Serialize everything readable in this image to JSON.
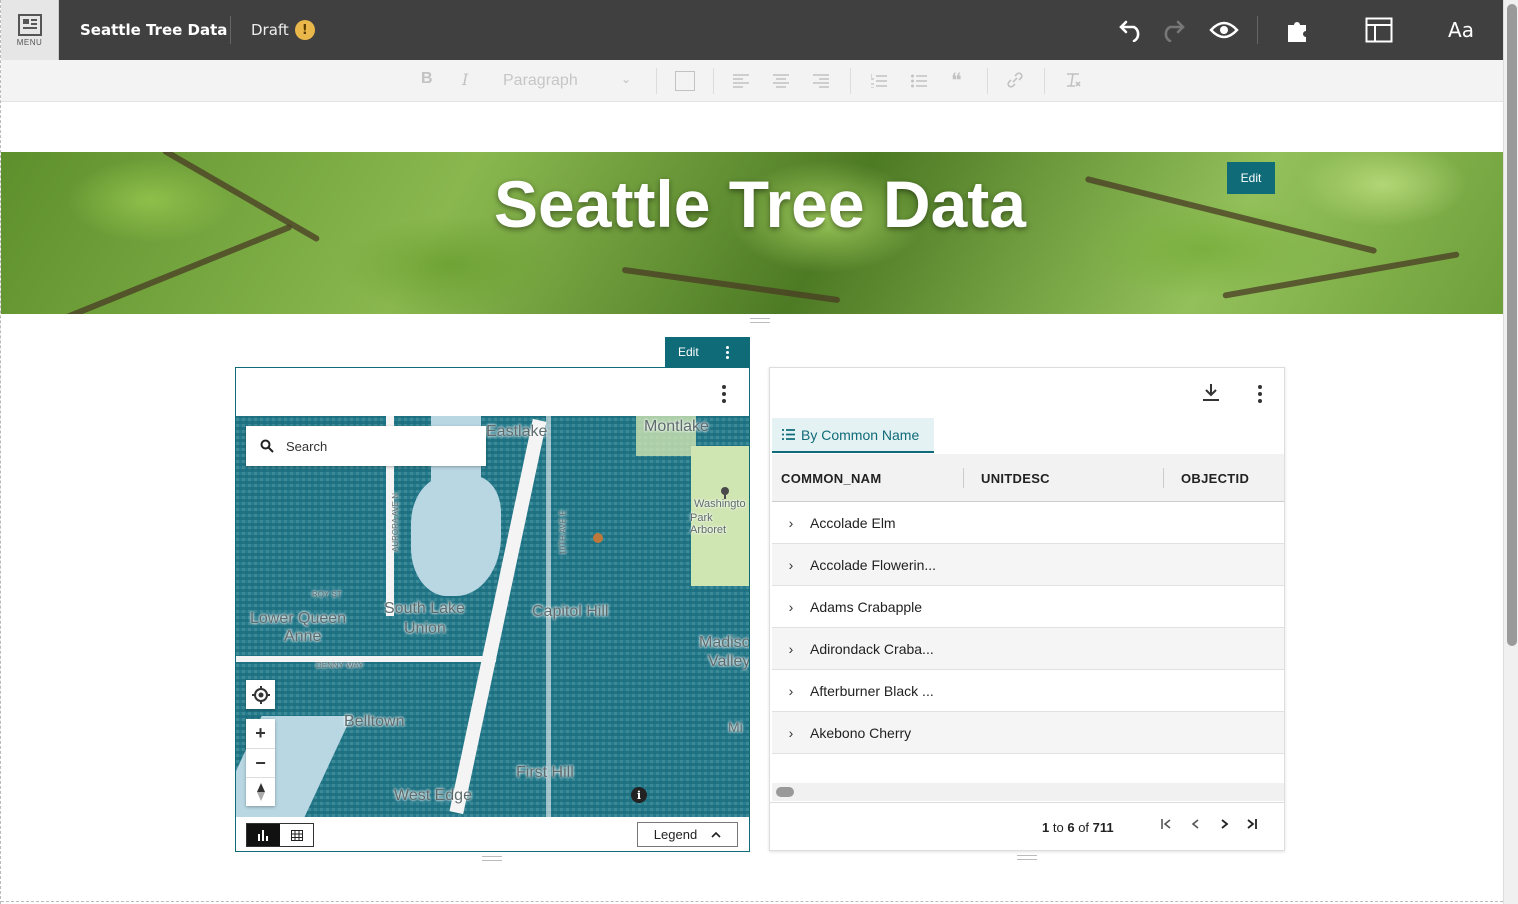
{
  "topbar": {
    "menu_label": "MENU",
    "title": "Seattle Tree Data",
    "status": "Draft",
    "status_badge": "!",
    "typography_label": "Aa",
    "icons": [
      "undo-icon",
      "redo-icon",
      "preview-eye-icon",
      "puzzle-icon",
      "layout-icon"
    ]
  },
  "format_toolbar": {
    "bold": "B",
    "italic": "I",
    "paragraph": "Paragraph"
  },
  "banner": {
    "title": "Seattle Tree Data",
    "edit_label": "Edit"
  },
  "map_card": {
    "edit_label": "Edit",
    "search_placeholder": "Search",
    "legend_label": "Legend",
    "info_label": "i",
    "zoom_in": "+",
    "zoom_out": "−",
    "labels": {
      "eastlake": "Eastlake",
      "montlake": "Montlake",
      "washington": "Washingto",
      "arboretum": "Park Arboret",
      "lower_queen": "Lower Queen",
      "anne": "Anne",
      "south_lake": "South Lake",
      "union": "Union",
      "capitol_hill": "Capitol Hill",
      "madison": "Madiso",
      "valley": "Valley",
      "belltown": "Belltown",
      "first_hill": "First Hill",
      "west_edge": "West Edge",
      "ave_10th": "10TH AVE E",
      "aurora": "AURORA AVE N",
      "denny": "DENNY WAY",
      "roy": "ROY ST",
      "mi": "Mi"
    }
  },
  "table_card": {
    "tab_label": "By Common Name",
    "columns": [
      "COMMON_NAM",
      "UNITDESC",
      "OBJECTID"
    ],
    "rows": [
      "Accolade Elm",
      "Accolade Flowerin...",
      "Adams Crabapple",
      "Adirondack Craba...",
      "Afterburner Black ...",
      "Akebono Cherry"
    ],
    "pager": {
      "from": "1",
      "to_word": "to",
      "to": "6",
      "of_word": "of",
      "total": "711"
    }
  },
  "colors": {
    "accent": "#0f6b78",
    "topbar": "#404040",
    "status_warning": "#e9b74a"
  }
}
